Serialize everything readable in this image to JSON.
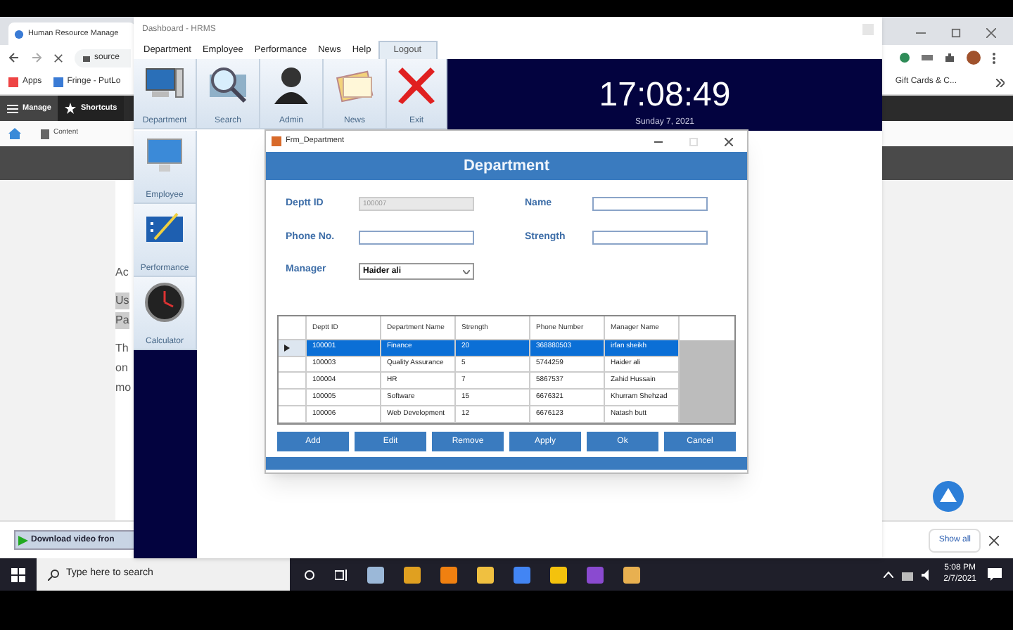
{
  "browser": {
    "tab_title": "Human Resource Manage",
    "address": "source",
    "bookmarks": [
      "Apps",
      "Fringe - PutLo"
    ],
    "bookmarks_right": "Gift Cards & C...",
    "toolbar": [
      "Manage",
      "Shortcuts"
    ],
    "nav": "Content",
    "content_fragments": [
      {
        "text": "Ac",
        "highlighted": false
      },
      {
        "text": "Us",
        "highlighted": true
      },
      {
        "text": "Pa",
        "highlighted": true
      },
      {
        "text": "Th",
        "highlighted": false
      },
      {
        "text": "on",
        "highlighted": false
      },
      {
        "text": "mo",
        "highlighted": false
      }
    ],
    "download": {
      "file": "Download video fron",
      "show_all": "Show all"
    }
  },
  "app": {
    "title": "Dashboard - HRMS",
    "menu": [
      {
        "label": "Department",
        "kind": "menu"
      },
      {
        "label": "Employee",
        "kind": "menu"
      },
      {
        "label": "Performance",
        "kind": "menu"
      },
      {
        "label": "News",
        "kind": "menu"
      },
      {
        "label": "Help",
        "kind": "menu"
      },
      {
        "label": "Logout",
        "kind": "tab"
      }
    ],
    "toolbar": [
      {
        "label": "Department",
        "kind": "computer"
      },
      {
        "label": "Search",
        "kind": "search"
      },
      {
        "label": "Admin",
        "kind": "person"
      },
      {
        "label": "News",
        "kind": "notes"
      },
      {
        "label": "Exit",
        "kind": "exit"
      }
    ],
    "sidebar": [
      {
        "label": "Employee",
        "kind": "monitor"
      },
      {
        "label": "Performance",
        "kind": "chart"
      },
      {
        "label": "Calculator",
        "kind": "clock"
      }
    ],
    "clock": {
      "time": "17:08:49",
      "date": "Sunday 7, 2021"
    }
  },
  "dialog": {
    "title": "Frm_Department",
    "header": "Department",
    "fields": [
      {
        "label": "Deptt ID",
        "kind": "text",
        "value": "100007",
        "disabled": true
      },
      {
        "label": "Name",
        "kind": "text",
        "disabled": false
      },
      {
        "label": "Phone No.",
        "kind": "text",
        "disabled": false
      },
      {
        "label": "Strength",
        "kind": "text",
        "disabled": false
      },
      {
        "label": "Manager",
        "kind": "dropdown",
        "value": "Haider ali",
        "disabled": false
      }
    ],
    "grid": {
      "columns": [
        "Deptt ID",
        "Department Name",
        "Strength",
        "Phone Number",
        "Manager Name"
      ],
      "rows": [
        {
          "cells": [
            "100001",
            "Finance",
            "20",
            "368880503",
            "irfan sheikh"
          ],
          "selected": true
        },
        {
          "cells": [
            "100003",
            "Quality Assurance",
            "5",
            "5744259",
            "Haider ali"
          ],
          "selected": false
        },
        {
          "cells": [
            "100004",
            "HR",
            "7",
            "5867537",
            "Zahid Hussain"
          ],
          "selected": false
        },
        {
          "cells": [
            "100005",
            "Software",
            "15",
            "6676321",
            "Khurram Shehzad"
          ],
          "selected": false
        },
        {
          "cells": [
            "100006",
            "Web Development",
            "12",
            "6676123",
            "Natash butt"
          ],
          "selected": false
        }
      ]
    },
    "buttons": [
      "Add",
      "Edit",
      "Remove",
      "Apply",
      "Ok",
      "Cancel"
    ]
  },
  "taskbar": {
    "search_placeholder": "Type here to search",
    "time": "5:08 PM",
    "date": "2/7/2021"
  }
}
